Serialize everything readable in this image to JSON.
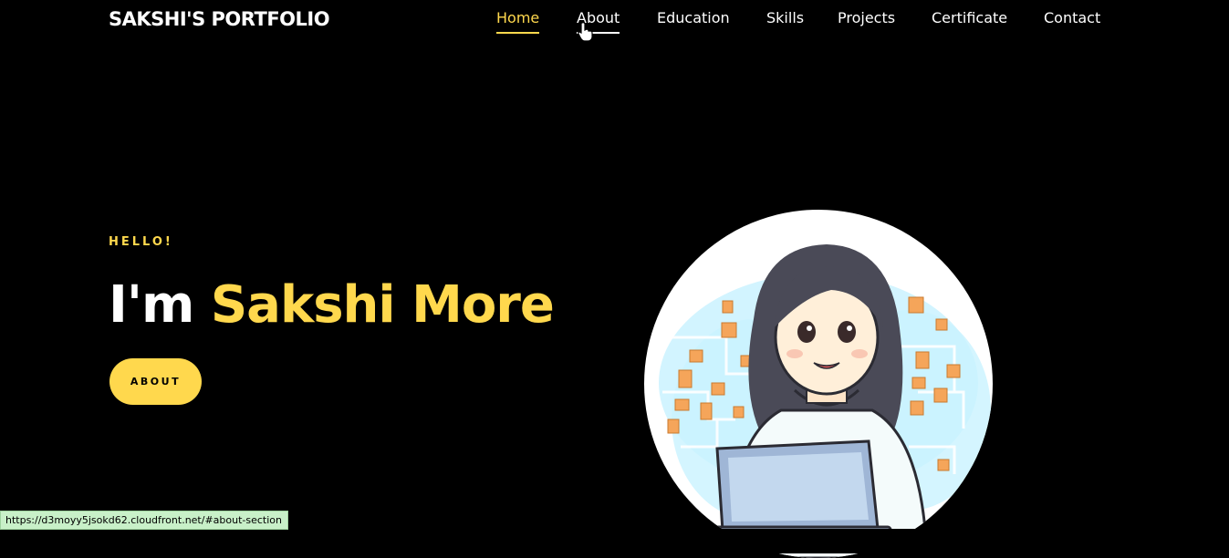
{
  "brand": {
    "title": "SAKSHI'S PORTFOLIO"
  },
  "nav": {
    "items": [
      {
        "label": "Home"
      },
      {
        "label": "About"
      },
      {
        "label": "Education"
      },
      {
        "label": "Skills"
      },
      {
        "label": "Projects"
      },
      {
        "label": "Certificate"
      },
      {
        "label": "Contact"
      }
    ],
    "active": "Home",
    "hovered": "About"
  },
  "hero": {
    "greeting": "HELLO!",
    "intro": "I'm",
    "name": "Sakshi More",
    "button_label": "ABOUT",
    "avatar_icon": "girl-with-laptop-illustration"
  },
  "status_bar": {
    "url": "https://d3moyy5jsokd62.cloudfront.net/#about-section"
  },
  "colors": {
    "accent": "#ffd84d",
    "background": "#000000",
    "text": "#ffffff"
  }
}
